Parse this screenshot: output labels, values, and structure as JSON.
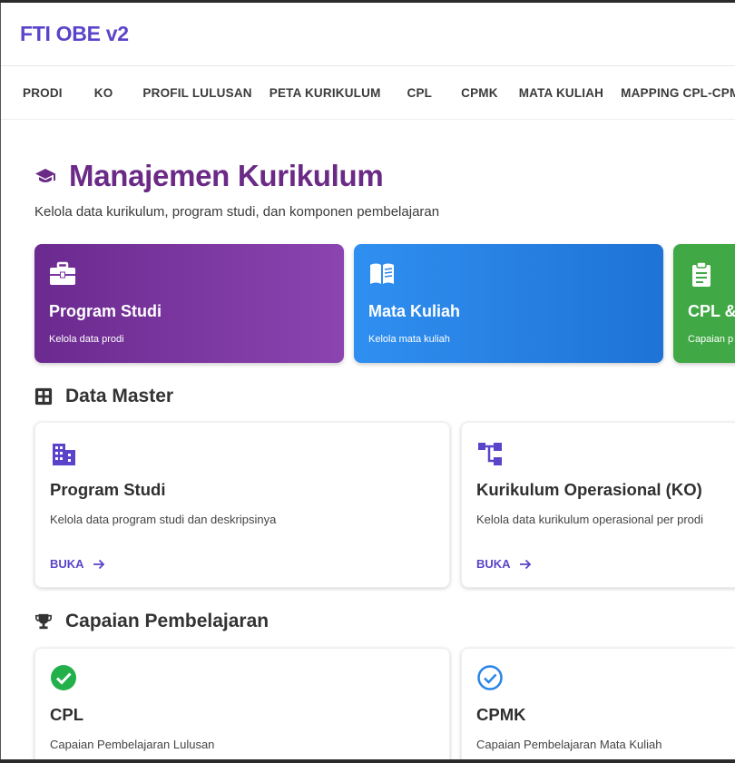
{
  "app": {
    "title": "FTI OBE v2"
  },
  "nav": [
    "PRODI",
    "KO",
    "PROFIL LULUSAN",
    "PETA KURIKULUM",
    "CPL",
    "CPMK",
    "MATA KULIAH",
    "MAPPING CPL-CPMK"
  ],
  "page": {
    "title": "Manajemen Kurikulum",
    "subtitle": "Kelola data kurikulum, program studi, dan komponen pembelajaran",
    "icon": "graduation-cap-icon"
  },
  "quick_cards": [
    {
      "title": "Program Studi",
      "subtitle": "Kelola data prodi",
      "icon": "briefcase-icon",
      "color": "#7b37a0"
    },
    {
      "title": "Mata Kuliah",
      "subtitle": "Kelola mata kuliah",
      "icon": "book-icon",
      "color": "#2a84e8"
    },
    {
      "title": "CPL &",
      "subtitle": "Capaian p",
      "icon": "clipboard-icon",
      "color": "#40a844"
    }
  ],
  "sections": {
    "data_master": {
      "title": "Data Master",
      "icon": "grid-icon",
      "cards": [
        {
          "title": "Program Studi",
          "description": "Kelola data program studi dan deskripsinya",
          "action": "BUKA",
          "icon": "building-icon"
        },
        {
          "title": "Kurikulum Operasional (KO)",
          "description": "Kelola data kurikulum operasional per prodi",
          "action": "BUKA",
          "icon": "hierarchy-icon"
        }
      ]
    },
    "capaian": {
      "title": "Capaian Pembelajaran",
      "icon": "trophy-icon",
      "cards": [
        {
          "title": "CPL",
          "description": "Capaian Pembelajaran Lulusan",
          "icon": "check-circle-filled-icon",
          "color": "#22b04b"
        },
        {
          "title": "CPMK",
          "description": "Capaian Pembelajaran Mata Kuliah",
          "icon": "check-circle-outline-icon",
          "color": "#2a84e8"
        }
      ]
    }
  },
  "colors": {
    "accent": "#5b44c9",
    "title": "#6a2a86"
  }
}
